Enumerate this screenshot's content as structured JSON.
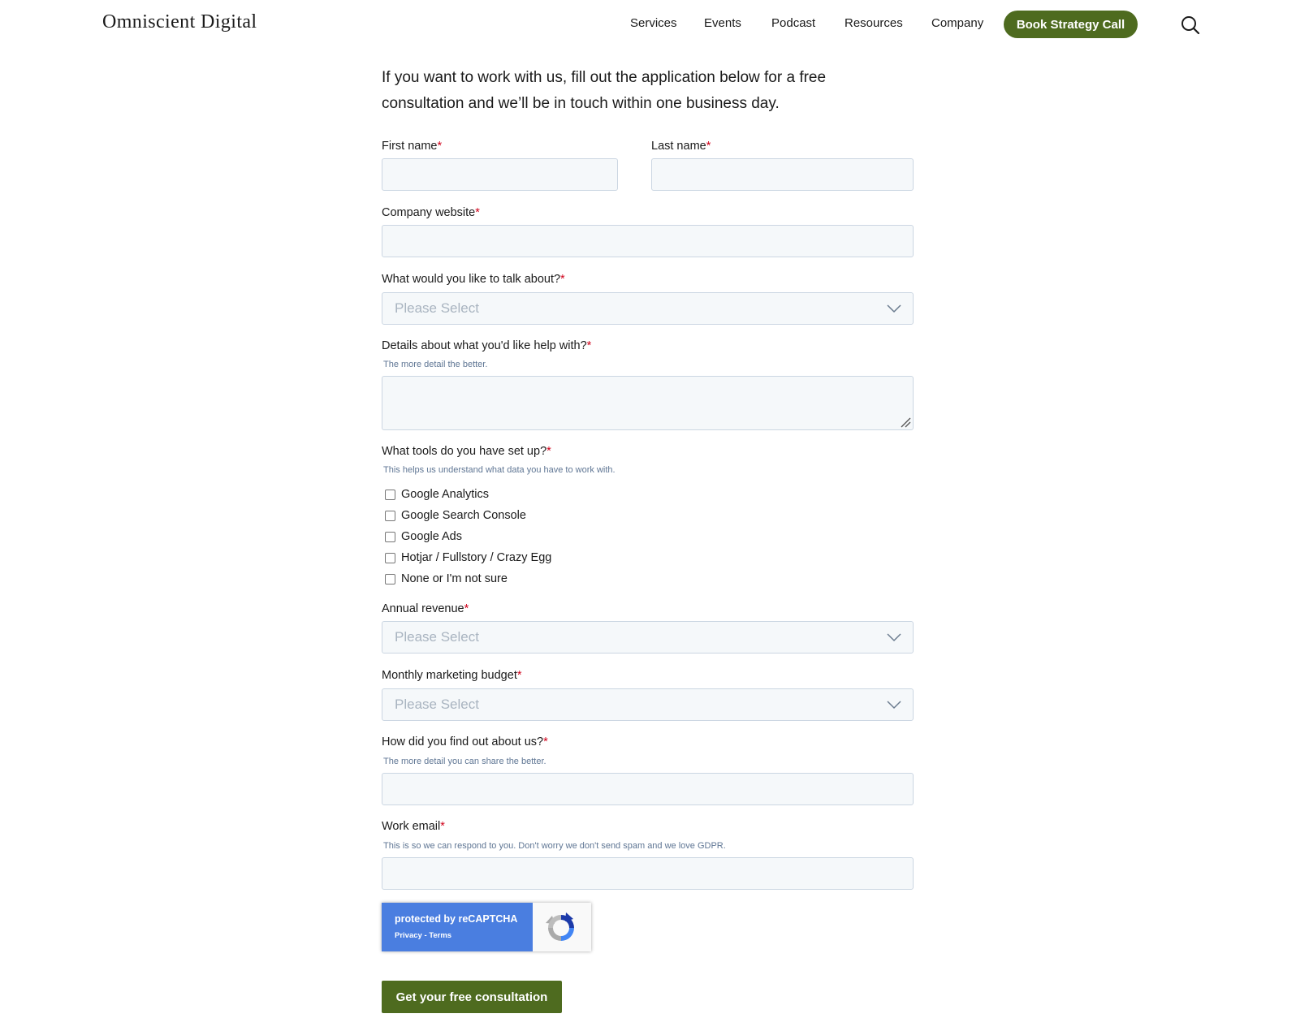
{
  "header": {
    "logo": "Omniscient Digital",
    "nav": [
      {
        "label": "Services"
      },
      {
        "label": "Events"
      },
      {
        "label": "Podcast"
      },
      {
        "label": "Resources"
      },
      {
        "label": "Company"
      }
    ],
    "cta_label": "Book Strategy Call",
    "search_icon": "search-icon"
  },
  "intro": "If you want to work with us, fill out the application below for a free consultation and we’ll be in touch within one business day.",
  "form": {
    "required_mark": "*",
    "first_name": {
      "label": "First name",
      "value": ""
    },
    "last_name": {
      "label": "Last name",
      "value": ""
    },
    "company_website": {
      "label": "Company website",
      "value": ""
    },
    "talk_about": {
      "label": "What would you like to talk about?",
      "selected": "Please Select"
    },
    "details": {
      "label": "Details about what you'd like help with?",
      "help": "The more detail the better.",
      "value": ""
    },
    "tools": {
      "label": "What tools do you have set up?",
      "help": "This helps us understand what data you have to work with.",
      "options": [
        {
          "label": "Google Analytics",
          "checked": false
        },
        {
          "label": "Google Search Console",
          "checked": false
        },
        {
          "label": "Google Ads",
          "checked": false
        },
        {
          "label": "Hotjar / Fullstory / Crazy Egg",
          "checked": false
        },
        {
          "label": "None or I'm not sure",
          "checked": false
        }
      ]
    },
    "annual_revenue": {
      "label": "Annual revenue",
      "selected": "Please Select"
    },
    "marketing_budget": {
      "label": "Monthly marketing budget",
      "selected": "Please Select"
    },
    "found_us": {
      "label": "How did you find out about us?",
      "help": "The more detail you can share the better.",
      "value": ""
    },
    "work_email": {
      "label": "Work email",
      "help": "This is so we can respond to you. Don't worry we don't send spam and we love GDPR.",
      "value": ""
    },
    "recaptcha": {
      "title": "protected by reCAPTCHA",
      "privacy": "Privacy",
      "separator": " - ",
      "terms": "Terms"
    },
    "submit_label": "Get your free consultation"
  },
  "colors": {
    "brand_green": "#4e6b1f",
    "required_red": "#d0021b",
    "field_bg": "#f5f8fa",
    "field_border": "#cbd6e2",
    "help_text": "#5f7694",
    "recaptcha_blue": "#4a7ee0"
  }
}
